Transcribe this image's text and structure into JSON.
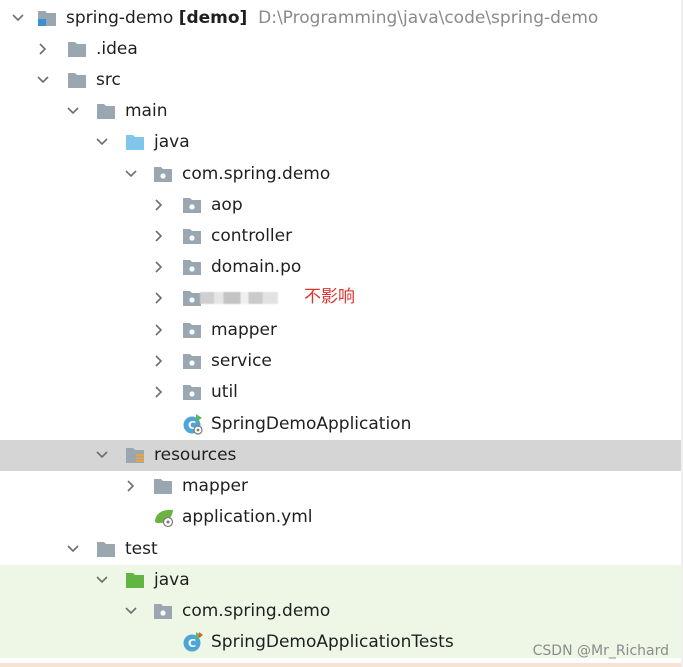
{
  "tree": {
    "root": {
      "name": "spring-demo",
      "module": "[demo]",
      "path": "D:\\Programming\\java\\code\\spring-demo"
    },
    "idea": ".idea",
    "src": "src",
    "main": "main",
    "java": "java",
    "package": "com.spring.demo",
    "aop": "aop",
    "controller": "controller",
    "domain": "domain.po",
    "redacted_note": "不影响",
    "mapper": "mapper",
    "service": "service",
    "util": "util",
    "app": "SpringDemoApplication",
    "resources": "resources",
    "res_mapper": "mapper",
    "yml": "application.yml",
    "test": "test",
    "test_java": "java",
    "test_package": "com.spring.demo",
    "tests": "SpringDemoApplicationTests"
  },
  "watermark": "CSDN @Mr_Richard",
  "colors": {
    "selected_row": "#d5d5d5",
    "test_row": "#eef7e6",
    "folder": "#9aa7b0",
    "source_folder": "#7fc6e8",
    "test_folder": "#62b543",
    "note_red": "#e0332e"
  }
}
